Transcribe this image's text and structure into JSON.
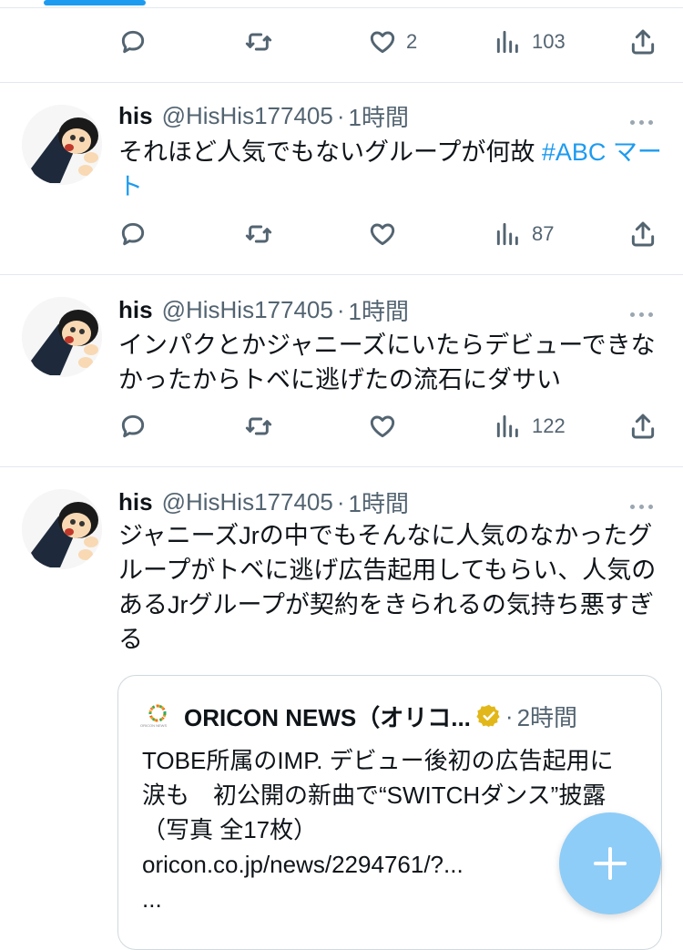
{
  "tweets": [
    {
      "counts": {
        "reply": "",
        "retweet": "",
        "like": "2",
        "views": "103"
      }
    },
    {
      "name": "his",
      "handle": "@HisHis177405",
      "dot": "·",
      "time": "1時間",
      "text_plain": "それほど人気でもないグループが何故 ",
      "hashtag": "#ABC マート",
      "counts": {
        "reply": "",
        "retweet": "",
        "like": "",
        "views": "87"
      }
    },
    {
      "name": "his",
      "handle": "@HisHis177405",
      "dot": "·",
      "time": "1時間",
      "text": "インパクとかジャニーズにいたらデビューできなかったからトベに逃げたの流石にダサい",
      "counts": {
        "reply": "",
        "retweet": "",
        "like": "",
        "views": "122"
      }
    },
    {
      "name": "his",
      "handle": "@HisHis177405",
      "dot": "·",
      "time": "1時間",
      "text": "ジャニーズJrの中でもそんなに人気のなかったグループがトベに逃げ広告起用してもらい、人気のあるJrグループが契約をきられるの気持ち悪すぎる",
      "quote": {
        "name": "ORICON NEWS（オリコ...",
        "dot": "·",
        "time": "2時間",
        "logo_caption": "ORICON NEWS",
        "text": "TOBE所属のIMP. デビュー後初の広告起用に涙も　初公開の新曲で“SWITCHダンス”披露（写真 全17枚）",
        "link": "oricon.co.jp/news/2294761/?...",
        "ellipsis": "..."
      }
    }
  ],
  "icons": {
    "reply": "reply-icon",
    "retweet": "retweet-icon",
    "like": "heart-icon",
    "views": "views-icon",
    "share": "share-icon",
    "more": "more-icon",
    "verified": "verified-badge-icon",
    "compose": "compose-plus-icon"
  },
  "colors": {
    "accent": "#1d9bf0",
    "fab": "#8ecdf8",
    "muted": "#536471",
    "verified_gold": "#e2b719"
  }
}
